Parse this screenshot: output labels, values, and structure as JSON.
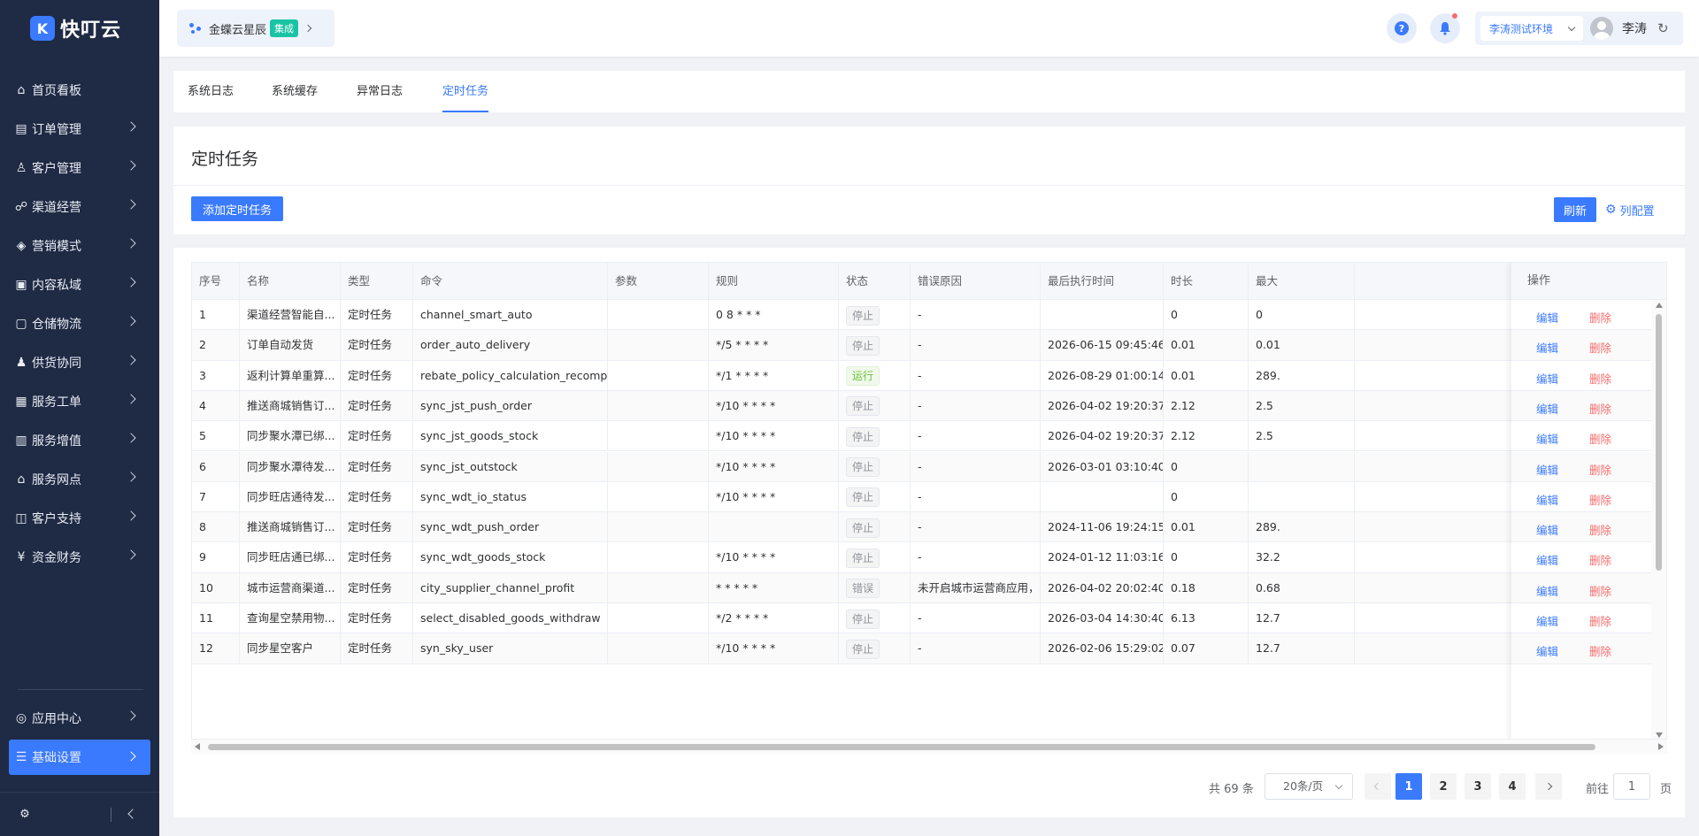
{
  "app": {
    "logo_glyph": "K",
    "logo_text": "快叮云"
  },
  "sidebar": {
    "items": [
      {
        "label": "首页看板",
        "icon": "home-icon",
        "glyph": "⌂",
        "arrow": false
      },
      {
        "label": "订单管理",
        "icon": "clipboard-icon",
        "glyph": "▤",
        "arrow": true
      },
      {
        "label": "客户管理",
        "icon": "user-icon",
        "glyph": "♙",
        "arrow": true
      },
      {
        "label": "渠道经营",
        "icon": "channel-icon",
        "glyph": "☍",
        "arrow": true
      },
      {
        "label": "营销模式",
        "icon": "tag-icon",
        "glyph": "◈",
        "arrow": true
      },
      {
        "label": "内容私域",
        "icon": "image-icon",
        "glyph": "▣",
        "arrow": true
      },
      {
        "label": "仓储物流",
        "icon": "warehouse-icon",
        "glyph": "▢",
        "arrow": true
      },
      {
        "label": "供货协同",
        "icon": "supply-icon",
        "glyph": "♟",
        "arrow": true
      },
      {
        "label": "服务工单",
        "icon": "workorder-icon",
        "glyph": "▦",
        "arrow": true
      },
      {
        "label": "服务增值",
        "icon": "bag-icon",
        "glyph": "▥",
        "arrow": true
      },
      {
        "label": "服务网点",
        "icon": "store-icon",
        "glyph": "⌂",
        "arrow": true
      },
      {
        "label": "客户支持",
        "icon": "support-icon",
        "glyph": "◫",
        "arrow": true
      },
      {
        "label": "资金财务",
        "icon": "yen-icon",
        "glyph": "¥",
        "arrow": true
      }
    ],
    "bottom_items": [
      {
        "label": "应用中心",
        "icon": "app-center-icon",
        "glyph": "◎",
        "arrow": true,
        "active": false
      },
      {
        "label": "基础设置",
        "icon": "settings-list-icon",
        "glyph": "☰",
        "arrow": true,
        "active": true
      }
    ],
    "footer": {
      "gear_glyph": "⚙"
    }
  },
  "header": {
    "app_name": "金蝶云星辰",
    "app_tag": "集成",
    "help_glyph": "?",
    "bell_glyph": "🔔",
    "env": "李涛测试环境",
    "user": "李涛",
    "refresh_glyph": "↻"
  },
  "tabs": [
    {
      "label": "系统日志",
      "active": false
    },
    {
      "label": "系统缓存",
      "active": false
    },
    {
      "label": "异常日志",
      "active": false
    },
    {
      "label": "定时任务",
      "active": true
    }
  ],
  "page": {
    "title": "定时任务",
    "add_button": "添加定时任务",
    "refresh_button": "刷新",
    "column_config": "列配置",
    "column_config_glyph": "⚙"
  },
  "table": {
    "columns": [
      "序号",
      "名称",
      "类型",
      "命令",
      "参数",
      "规则",
      "状态",
      "错误原因",
      "最后执行时间",
      "时长",
      "最大"
    ],
    "ops_header": "操作",
    "edit_label": "编辑",
    "delete_label": "删除",
    "rows": [
      {
        "no": "1",
        "name": "渠道经营智能自...",
        "type": "定时任务",
        "cmd": "channel_smart_auto",
        "param": "",
        "rule": "0 8 * * *",
        "status": "停止",
        "error": "-",
        "last": "",
        "dur": "0",
        "max": "0"
      },
      {
        "no": "2",
        "name": "订单自动发货",
        "type": "定时任务",
        "cmd": "order_auto_delivery",
        "param": "",
        "rule": "*/5 * * * *",
        "status": "停止",
        "error": "-",
        "last": "2026-06-15 09:45:46",
        "dur": "0.01",
        "max": "0.01"
      },
      {
        "no": "3",
        "name": "返利计算单重算...",
        "type": "定时任务",
        "cmd": "rebate_policy_calculation_recompute",
        "param": "",
        "rule": "*/1 * * * *",
        "status": "运行",
        "error": "-",
        "last": "2026-08-29 01:00:14",
        "dur": "0.01",
        "max": "289."
      },
      {
        "no": "4",
        "name": "推送商城销售订...",
        "type": "定时任务",
        "cmd": "sync_jst_push_order",
        "param": "",
        "rule": "*/10 * * * *",
        "status": "停止",
        "error": "-",
        "last": "2026-04-02 19:20:37",
        "dur": "2.12",
        "max": "2.5"
      },
      {
        "no": "5",
        "name": "同步聚水潭已绑...",
        "type": "定时任务",
        "cmd": "sync_jst_goods_stock",
        "param": "",
        "rule": "*/10 * * * *",
        "status": "停止",
        "error": "-",
        "last": "2026-04-02 19:20:37",
        "dur": "2.12",
        "max": "2.5"
      },
      {
        "no": "6",
        "name": "同步聚水潭待发...",
        "type": "定时任务",
        "cmd": "sync_jst_outstock",
        "param": "",
        "rule": "*/10 * * * *",
        "status": "停止",
        "error": "-",
        "last": "2026-03-01 03:10:40",
        "dur": "0",
        "max": ""
      },
      {
        "no": "7",
        "name": "同步旺店通待发...",
        "type": "定时任务",
        "cmd": "sync_wdt_io_status",
        "param": "",
        "rule": "*/10 * * * *",
        "status": "停止",
        "error": "-",
        "last": "",
        "dur": "0",
        "max": ""
      },
      {
        "no": "8",
        "name": "推送商城销售订...",
        "type": "定时任务",
        "cmd": "sync_wdt_push_order",
        "param": "",
        "rule": "",
        "status": "停止",
        "error": "-",
        "last": "2024-11-06 19:24:15",
        "dur": "0.01",
        "max": "289."
      },
      {
        "no": "9",
        "name": "同步旺店通已绑...",
        "type": "定时任务",
        "cmd": "sync_wdt_goods_stock",
        "param": "",
        "rule": "*/10 * * * *",
        "status": "停止",
        "error": "-",
        "last": "2024-01-12 11:03:16",
        "dur": "0",
        "max": "32.2"
      },
      {
        "no": "10",
        "name": "城市运营商渠道...",
        "type": "定时任务",
        "cmd": "city_supplier_channel_profit",
        "param": "",
        "rule": "* * * * *",
        "status": "错误",
        "error": "未开启城市运营商应用，...",
        "last": "2026-04-02 20:02:40",
        "dur": "0.18",
        "max": "0.68"
      },
      {
        "no": "11",
        "name": "查询星空禁用物...",
        "type": "定时任务",
        "cmd": "select_disabled_goods_withdraw",
        "param": "",
        "rule": "*/2 * * * *",
        "status": "停止",
        "error": "-",
        "last": "2026-03-04 14:30:40",
        "dur": "6.13",
        "max": "12.7"
      },
      {
        "no": "12",
        "name": "同步星空客户",
        "type": "定时任务",
        "cmd": "syn_sky_user",
        "param": "",
        "rule": "*/10 * * * *",
        "status": "停止",
        "error": "-",
        "last": "2026-02-06 15:29:02",
        "dur": "0.07",
        "max": "12.7"
      }
    ]
  },
  "pagination": {
    "total": "共 69 条",
    "page_size": "20条/页",
    "pages": [
      "1",
      "2",
      "3",
      "4"
    ],
    "current": "1",
    "goto_label": "前往",
    "goto_value": "1",
    "goto_unit": "页"
  },
  "colors": {
    "primary": "#3a7afe",
    "sidebar_bg": "#1f2a44",
    "danger": "#f56c6c",
    "success": "#67c23a"
  }
}
